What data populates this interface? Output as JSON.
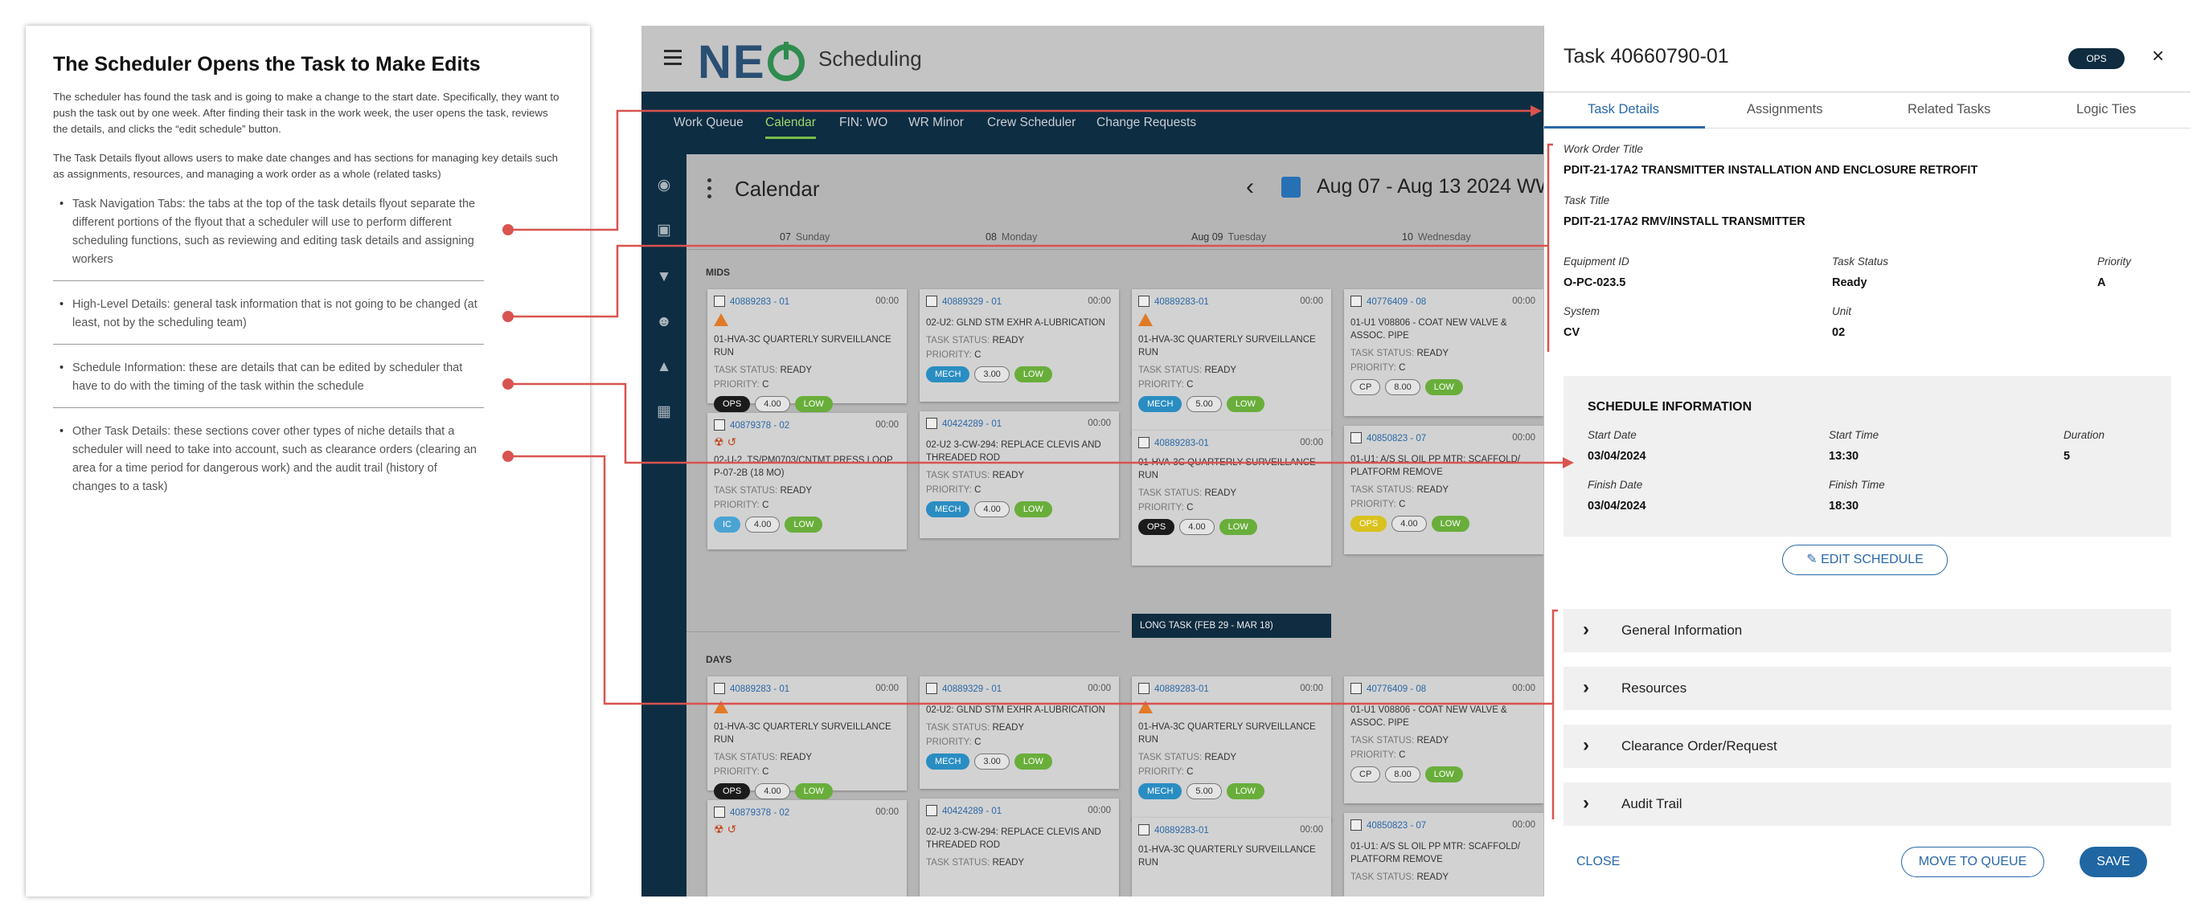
{
  "doc": {
    "title": "The Scheduler Opens the Task to Make Edits",
    "para1": "The scheduler has found the task and is going to make a change to the start date. Specifically, they want to push the task out by one week. After finding their task in the work week, the user opens the task, reviews the details, and clicks the “edit schedule” button.",
    "para2": "The Task Details flyout allows users to make date changes  and has sections for managing key details such as assignments, resources, and managing a work order as a whole (related tasks)",
    "bullets": [
      "Task Navigation Tabs: the tabs at the top of the task details flyout separate the different portions of the flyout that a scheduler will use to perform different scheduling functions, such as reviewing and editing task details and assigning workers",
      "High-Level Details: general task information that is not going to be changed (at least, not by the scheduling team)",
      "Schedule Information: these are details that can be edited by scheduler that have to do with the timing of the task within the schedule",
      "Other Task Details: these sections cover other types of niche details that a scheduler will need to take into account, such as clearance orders (clearing an area for a time period for dangerous work) and the audit trail (history of changes to a task)"
    ]
  },
  "app": {
    "title": "Scheduling",
    "logo": "NE",
    "nav": [
      "Work Queue",
      "Calendar",
      "FIN: WO",
      "WR Minor",
      "Crew Scheduler",
      "Change Requests"
    ],
    "calendar_title": "Calendar",
    "date_range": "Aug 07 -  Aug 13 2024 WW",
    "days": [
      {
        "num": "07",
        "name": "Sunday"
      },
      {
        "num": "08",
        "name": "Monday"
      },
      {
        "num": "Aug 09",
        "name": "Tuesday"
      },
      {
        "num": "10",
        "name": "Wednesday"
      }
    ],
    "sections": {
      "mids": "MIDS",
      "days": "DAYS"
    },
    "status_label": "TASK STATUS:",
    "priority_label": "PRIORITY:",
    "cards": {
      "c1": {
        "id": "40889283 - 01",
        "time": "00:00",
        "title": "01-HVA-3C QUARTERLY SURVEILLANCE RUN",
        "status": "READY",
        "priority": "C",
        "tags": [
          "OPS",
          "4.00",
          "LOW"
        ]
      },
      "c2": {
        "id": "40879378 - 02",
        "time": "00:00",
        "title": "02-U-2, TS/PM0703/CNTMT PRESS LOOP P-07-2B (18 MO)",
        "status": "READY",
        "priority": "C",
        "tags": [
          "IC",
          "4.00",
          "LOW"
        ]
      },
      "c3": {
        "id": "40889329 - 01",
        "time": "00:00",
        "title": "02-U2: GLND STM EXHR A-LUBRICATION",
        "status": "READY",
        "priority": "C",
        "tags": [
          "MECH",
          "3.00",
          "LOW"
        ]
      },
      "c4": {
        "id": "40424289 - 01",
        "time": "00:00",
        "title": "02-U2 3-CW-294: REPLACE CLEVIS AND THREADED ROD",
        "status": "READY",
        "priority": "C",
        "tags": [
          "MECH",
          "4.00",
          "LOW"
        ]
      },
      "c5": {
        "id": "40889283-01",
        "time": "00:00",
        "title": "01-HVA-3C QUARTERLY SURVEILLANCE RUN",
        "status": "READY",
        "priority": "C",
        "tags": [
          "MECH",
          "5.00",
          "LOW"
        ]
      },
      "c6": {
        "id": "40889283-01",
        "time": "00:00",
        "title": "01-HVA-3C QUARTERLY SURVEILLANCE RUN",
        "status": "READY",
        "priority": "C",
        "tags": [
          "OPS",
          "4.00",
          "LOW"
        ]
      },
      "c7": {
        "id": "40776409 - 08",
        "time": "00:00",
        "title": "01-U1 V08806 - COAT NEW VALVE & ASSOC. PIPE",
        "status": "READY",
        "priority": "C",
        "tags": [
          "CP",
          "8.00",
          "LOW"
        ]
      },
      "c8": {
        "id": "40850823 - 07",
        "time": "00:00",
        "title": "01-U1: A/S SL OIL PP MTR: SCAFFOLD/ PLATFORM REMOVE",
        "status": "READY",
        "priority": "C",
        "tags": [
          "OPS",
          "4.00",
          "LOW"
        ]
      }
    },
    "long_task": "LONG TASK (FEB 29 - MAR 18)"
  },
  "flyout": {
    "title": "Task 40660790-01",
    "badge": "OPS",
    "close_icon": "×",
    "tabs": [
      "Task Details",
      "Assignments",
      "Related Tasks",
      "Logic Ties"
    ],
    "wo_title_label": "Work Order Title",
    "wo_title": "PDIT-21-17A2 TRANSMITTER INSTALLATION AND ENCLOSURE RETROFIT",
    "task_title_label": "Task Title",
    "task_title": "PDIT-21-17A2 RMV/INSTALL TRANSMITTER",
    "equipment_label": "Equipment ID",
    "equipment": "O-PC-023.5",
    "status_label": "Task Status",
    "status": "Ready",
    "priority_label": "Priority",
    "priority": "A",
    "system_label": "System",
    "system": "CV",
    "unit_label": "Unit",
    "unit": "02",
    "schedule": {
      "heading": "SCHEDULE INFORMATION",
      "start_date_label": "Start Date",
      "start_date": "03/04/2024",
      "start_time_label": "Start Time",
      "start_time": "13:30",
      "duration_label": "Duration",
      "duration": "5",
      "finish_date_label": "Finish Date",
      "finish_date": "03/04/2024",
      "finish_time_label": "Finish Time",
      "finish_time": "18:30"
    },
    "edit_schedule": "EDIT SCHEDULE",
    "accordions": [
      "General Information",
      "Resources",
      "Clearance Order/Request",
      "Audit Trail"
    ],
    "close": "CLOSE",
    "move": "MOVE TO QUEUE",
    "save": "SAVE"
  },
  "colors": {
    "callout": "#d9534f",
    "navy": "#0d2d42",
    "accent": "#2968a8",
    "low": "#69ae3b"
  }
}
